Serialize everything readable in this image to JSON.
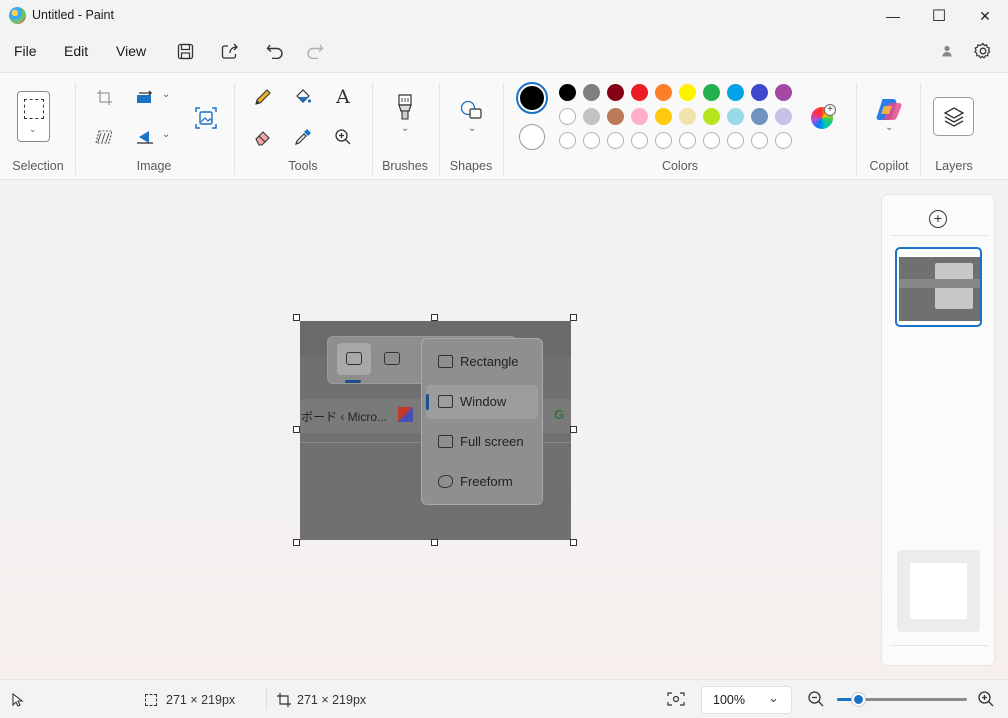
{
  "window": {
    "title": "Untitled - Paint",
    "minimize": "—",
    "maximize": "☐",
    "close": "✕"
  },
  "menu": {
    "file": "File",
    "edit": "Edit",
    "view": "View"
  },
  "ribbon": {
    "groups": {
      "selection": "Selection",
      "image": "Image",
      "tools": "Tools",
      "brushes": "Brushes",
      "shapes": "Shapes",
      "colors": "Colors",
      "copilot": "Copilot",
      "layers": "Layers"
    },
    "tools_text_icon": "A"
  },
  "colors": {
    "primary": "#000000",
    "secondary": "#ffffff",
    "row1": [
      "#000000",
      "#7f7f7f",
      "#880015",
      "#ed1c24",
      "#ff7f27",
      "#fff200",
      "#22b14c",
      "#00a2e8",
      "#3f48cc",
      "#a349a4"
    ],
    "row2": [
      "#ffffff",
      "#c3c3c3",
      "#b97a57",
      "#ffaec9",
      "#ffc90e",
      "#efe4b0",
      "#b5e61d",
      "#99d9ea",
      "#7092be",
      "#c8bfe7"
    ],
    "row3_count": 10
  },
  "canvas_image": {
    "menu_items": [
      "Rectangle",
      "Window",
      "Full screen",
      "Freeform"
    ],
    "selected_item": "Window",
    "tab_text": "ボード ‹ Micro..."
  },
  "status": {
    "selection_size": "271 × 219px",
    "canvas_size": "271 × 219px",
    "zoom": "100%"
  }
}
